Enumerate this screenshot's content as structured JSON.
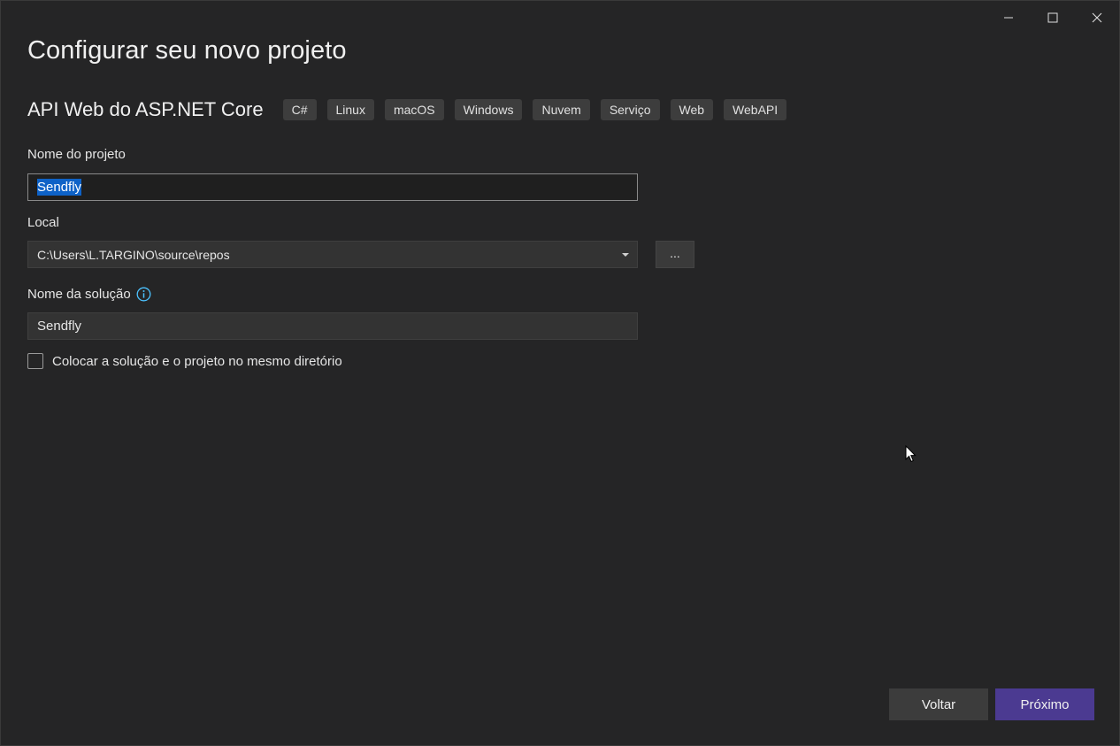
{
  "window": {
    "title": "Configurar seu novo projeto",
    "controls": [
      "minimize",
      "maximize",
      "close"
    ]
  },
  "template": {
    "name": "API Web do ASP.NET Core",
    "tags": [
      "C#",
      "Linux",
      "macOS",
      "Windows",
      "Nuvem",
      "Serviço",
      "Web",
      "WebAPI"
    ]
  },
  "project_name": {
    "label": "Nome do projeto",
    "value": "Sendfly"
  },
  "location": {
    "label": "Local",
    "value": "C:\\Users\\L.TARGINO\\source\\repos",
    "browse_label": "..."
  },
  "solution_name": {
    "label": "Nome da solução",
    "value": "Sendfly",
    "info_icon": "info-icon"
  },
  "same_directory": {
    "label": "Colocar a solução e o projeto no mesmo diretório",
    "checked": false
  },
  "footer": {
    "back_label": "Voltar",
    "next_label": "Próximo"
  },
  "colors": {
    "background": "#252526",
    "accent": "#4b3a91",
    "selection": "#0e62c7",
    "info": "#4cc2ff"
  }
}
